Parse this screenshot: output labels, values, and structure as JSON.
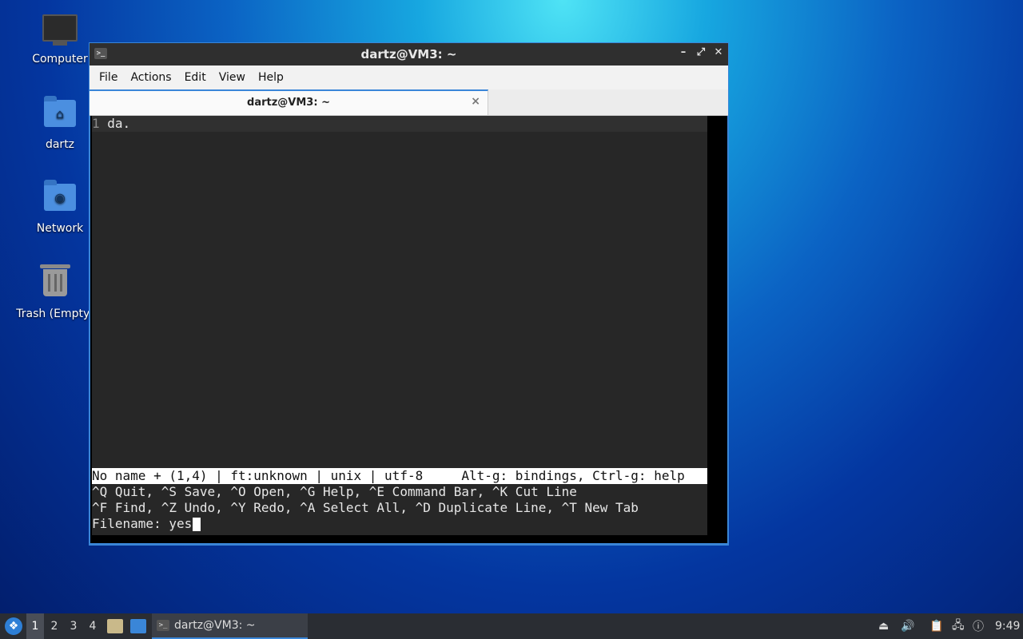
{
  "desktop": {
    "icons": [
      {
        "label": "Computer"
      },
      {
        "label": "dartz"
      },
      {
        "label": "Network"
      },
      {
        "label": "Trash (Empty)"
      }
    ]
  },
  "window": {
    "title": "dartz@VM3: ~",
    "menu": [
      "File",
      "Actions",
      "Edit",
      "View",
      "Help"
    ],
    "tab": {
      "label": "dartz@VM3: ~",
      "close": "×"
    },
    "controls": {
      "minimize": "–",
      "maximize": "⤢",
      "close": "✕"
    }
  },
  "editor": {
    "line_number": "1",
    "line_text": " da.",
    "status_line": "No name + (1,4) | ft:unknown | unix | utf-8     Alt-g: bindings, Ctrl-g: help",
    "help_line_1": "^Q Quit, ^S Save, ^O Open, ^G Help, ^E Command Bar, ^K Cut Line",
    "help_line_2": "^F Find, ^Z Undo, ^Y Redo, ^A Select All, ^D Duplicate Line, ^T New Tab",
    "prompt_label": "Filename: ",
    "prompt_value": "yes"
  },
  "taskbar": {
    "workspaces": [
      "1",
      "2",
      "3",
      "4"
    ],
    "active_workspace": "1",
    "task_label": "dartz@VM3: ~",
    "clock": "9:49"
  }
}
